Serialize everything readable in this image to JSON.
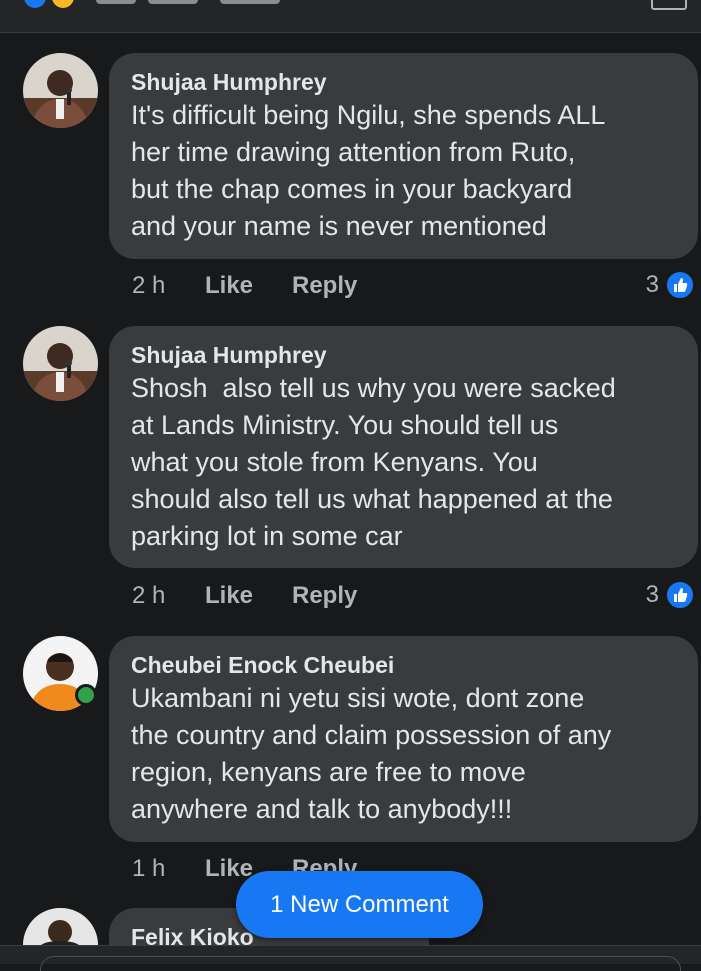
{
  "comments": [
    {
      "author": "Shujaa Humphrey",
      "text": "It's difficult being Ngilu, she spends ALL\nher time drawing attention from Ruto,\nbut the chap comes in your backyard\nand your name is never mentioned",
      "time": "2 h",
      "like_label": "Like",
      "reply_label": "Reply",
      "reaction_count": "3"
    },
    {
      "author": "Shujaa Humphrey",
      "text": "Shosh  also tell us why you were sacked\nat Lands Ministry. You should tell us\nwhat you stole from Kenyans. You\nshould also tell us what happened at the\nparking lot in some car",
      "time": "2 h",
      "like_label": "Like",
      "reply_label": "Reply",
      "reaction_count": "3"
    },
    {
      "author": "Cheubei Enock Cheubei",
      "text": "Ukambani ni yetu sisi wote, dont zone\nthe country and claim possession of any\nregion, kenyans are free to move\nanywhere and talk to anybody!!!",
      "time": "1 h",
      "like_label": "Like",
      "reply_label": "Reply"
    },
    {
      "author": "Felix Kioko"
    }
  ],
  "new_comment_label": "1 New Comment",
  "colors": {
    "background": "#18191a",
    "bubble": "#3a3b3c",
    "accent": "#1877f2",
    "online": "#31a24c"
  },
  "icons": [
    "like-reaction-icon",
    "online-status-icon"
  ]
}
